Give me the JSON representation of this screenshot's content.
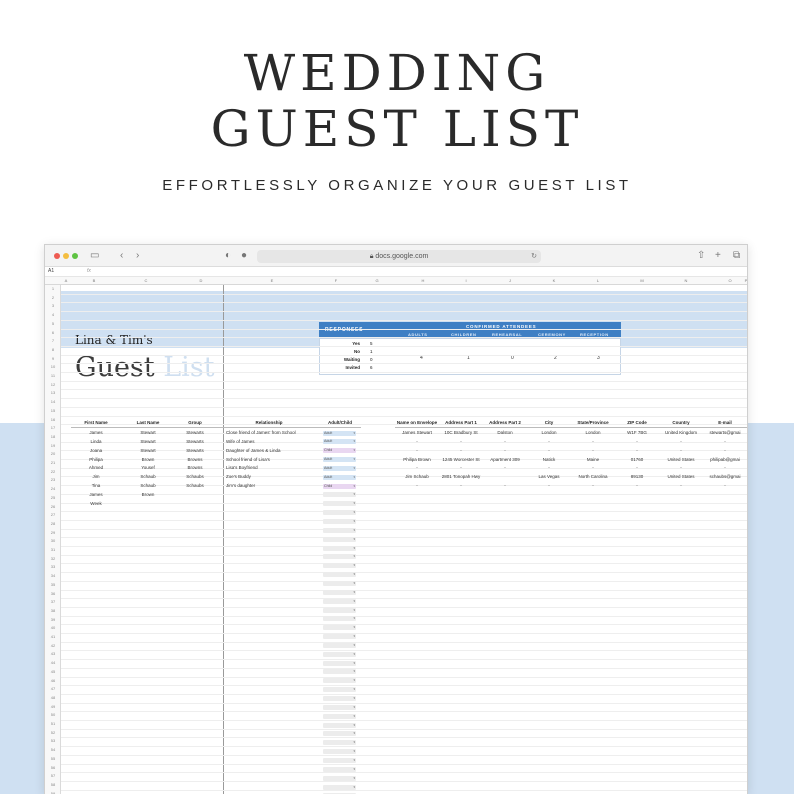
{
  "hero": {
    "title_line1": "WEDDING",
    "title_line2": "GUEST LIST",
    "subtitle": "EFFORTLESSLY ORGANIZE YOUR GUEST LIST"
  },
  "browser": {
    "url": "docs.google.com",
    "cell_ref": "A1",
    "fx": "fx"
  },
  "columns": [
    "A",
    "B",
    "C",
    "",
    "D",
    "E",
    "F",
    "G",
    "H",
    "I",
    "J",
    "K",
    "L",
    "M",
    "N",
    "O",
    "P"
  ],
  "sheet": {
    "heading_small": "Lina & Tim's",
    "heading_big_1": "Guest",
    "heading_big_2": "List"
  },
  "responses": {
    "label": "RESPONSES",
    "confirmed_label": "CONFIRMED ATTENDEES",
    "rows": [
      {
        "label": "Yes",
        "value": "5"
      },
      {
        "label": "No",
        "value": "1"
      },
      {
        "label": "Waiting",
        "value": "0"
      },
      {
        "label": "Invited",
        "value": "6"
      }
    ],
    "attendees": [
      {
        "label": "ADULTS",
        "value": "4"
      },
      {
        "label": "CHILDREN",
        "value": "1"
      },
      {
        "label": "REHEARSAL",
        "value": "0"
      },
      {
        "label": "CEREMONY",
        "value": "2"
      },
      {
        "label": "RECEPTION",
        "value": "3"
      }
    ]
  },
  "table": {
    "headers_left": [
      "First Name",
      "Last Name",
      "Group",
      "Relationship",
      "Adult/Child"
    ],
    "headers_right": [
      "Name on Envelope",
      "Address Part 1",
      "Address Part 2",
      "City",
      "State/Province",
      "ZIP Code",
      "Country",
      "E-mail"
    ],
    "guests": [
      {
        "first": "James",
        "last": "Stewart",
        "group": "Stewarts",
        "rel": "Close friend of James' from School",
        "type": "Adult"
      },
      {
        "first": "Linda",
        "last": "Stewart",
        "group": "Stewarts",
        "rel": "Wife of James",
        "type": "Adult"
      },
      {
        "first": "Joana",
        "last": "Stewart",
        "group": "Stewarts",
        "rel": "Daughter of James & Linda",
        "type": "Child"
      },
      {
        "first": "Philipa",
        "last": "Brown",
        "group": "Browns",
        "rel": "School friend of Lisa's",
        "type": "Adult"
      },
      {
        "first": "Ahmed",
        "last": "Yousef",
        "group": "Browns",
        "rel": "Lisa's Boyfriend",
        "type": "Adult"
      },
      {
        "first": "Jim",
        "last": "Schaub",
        "group": "Schaubs",
        "rel": "Zoe's Buddy",
        "type": "Adult"
      },
      {
        "first": "Tina",
        "last": "Schaub",
        "group": "Schaubs",
        "rel": "Jim's daughter",
        "type": "Child"
      },
      {
        "first": "James",
        "last": "Brown",
        "group": "",
        "rel": "",
        "type": ""
      },
      {
        "first": "Week",
        "last": "",
        "group": "",
        "rel": "",
        "type": ""
      }
    ],
    "addresses": [
      [
        "James Stewart",
        "10C Bradbury St",
        "Dalston",
        "London",
        "London",
        "W1F 7BG",
        "United Kingdom",
        "stewarts@gmai"
      ],
      [
        "-",
        "-",
        "-",
        "-",
        "-",
        "-",
        "-",
        "-"
      ],
      [
        "-",
        "-",
        "-",
        "-",
        "-",
        "-",
        "-",
        "-"
      ],
      [
        "Philipa Brown",
        "1245 Worcester St",
        "Apartment 309",
        "Natick",
        "Maine",
        "01760",
        "United States",
        "philipab@gmai"
      ],
      [
        "-",
        "-",
        "-",
        "-",
        "-",
        "-",
        "-",
        "-"
      ],
      [
        "Jim Schaub",
        "2801 Tonopah Hwy",
        "",
        "Las Vegas",
        "North Carolina",
        "89130",
        "United States",
        "schaubs@gmai"
      ],
      [
        "-",
        "-",
        "-",
        "-",
        "-",
        "-",
        "-",
        "-"
      ]
    ],
    "row_numbers_start": 1
  }
}
